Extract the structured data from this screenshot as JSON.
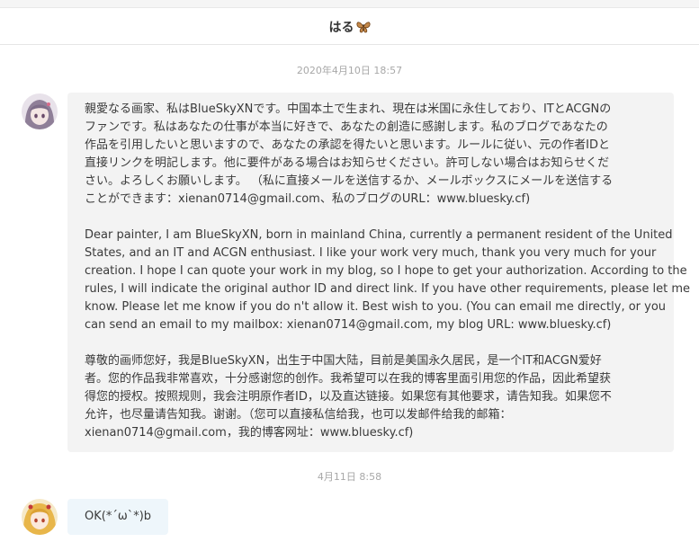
{
  "header": {
    "title": "はる",
    "emoji_icon": "butterfly-icon"
  },
  "messages": [
    {
      "timestamp": "2020年4月10日 18:57",
      "avatar": "anime-girl-avatar",
      "lines": [
        "親愛なる画家、私はBlueSkyXNです。中国本土で生まれ、現在は米国に永住しており、ITとACGNの",
        "ファンです。私はあなたの仕事が本当に好きで、あなたの創造に感謝します。私のブログであなたの",
        "作品を引用したいと思いますので、あなたの承認を得たいと思います。ルールに従い、元の作者IDと",
        "直接リンクを明記します。他に要件がある場合はお知らせください。許可しない場合はお知らせくだ",
        "さい。よろしくお願いします。 （私に直接メールを送信するか、メールボックスにメールを送信する",
        "ことができます：xienan0714@gmail.com、私のブログのURL：www.bluesky.cf)",
        "",
        "Dear painter, I am BlueSkyXN, born in mainland China, currently a permanent resident of the United",
        "States, and an IT and ACGN enthusiast. I like your work very much, thank you very much for your",
        "creation. I hope I can quote your work in my blog, so I hope to get your authorization. According to the",
        "rules, I will indicate the original author ID and direct link. If you have other requirements, please let me",
        "know. Please let me know if you do n't allow it. Best wish to you. (You can email me directly, or you",
        "can send an email to my mailbox: xienan0714@gmail.com, my blog URL: www.bluesky.cf)",
        "",
        "尊敬的画师您好，我是BlueSkyXN，出生于中国大陆，目前是美国永久居民，是一个IT和ACGN爱好",
        "者。您的作品我非常喜欢，十分感谢您的创作。我希望可以在我的博客里面引用您的作品，因此希望获",
        "得您的授权。按照规则，我会注明原作者ID，以及直达链接。如果您有其他要求，请告知我。如果您不",
        "允许，也尽量请告知我。谢谢。（您可以直接私信给我，也可以发邮件给我的邮箱：",
        "xienan0714@gmail.com，我的博客网址：www.bluesky.cf)"
      ]
    },
    {
      "timestamp": "4月11日 8:58",
      "avatar": "blonde-girl-avatar",
      "text": "OK(*´ω`*)b"
    }
  ]
}
